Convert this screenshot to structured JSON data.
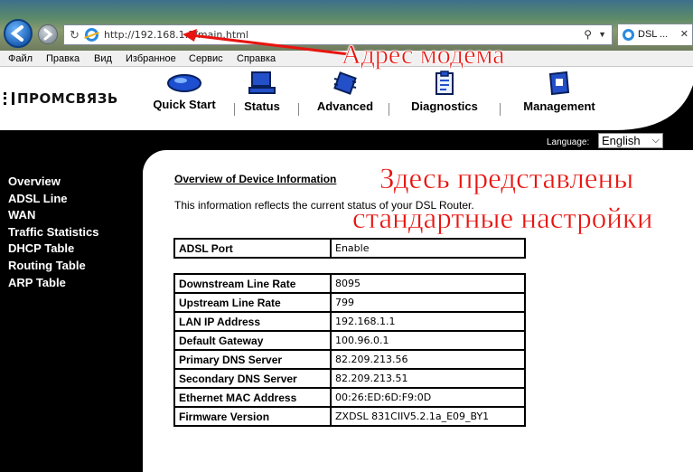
{
  "browser": {
    "url": "http://192.168.1.1/main.html",
    "tab_title": "DSL ...",
    "menu": [
      "Файл",
      "Правка",
      "Вид",
      "Избранное",
      "Сервис",
      "Справка"
    ]
  },
  "annotations": {
    "address_caption": "Адрес модема",
    "content_caption_line1": "Здесь представлены",
    "content_caption_line2": "стандартные настройки",
    "color": "#e8140f"
  },
  "router": {
    "brand": "ПРОМСВЯЗЬ",
    "nav": [
      {
        "label": "Quick Start",
        "icon": "mouse-icon"
      },
      {
        "label": "Status",
        "icon": "monitor-icon"
      },
      {
        "label": "Advanced",
        "icon": "chip-icon"
      },
      {
        "label": "Diagnostics",
        "icon": "clipboard-icon"
      },
      {
        "label": "Management",
        "icon": "book-icon"
      }
    ],
    "language_label": "Language:",
    "language_value": "English"
  },
  "sidebar": {
    "items": [
      "Overview",
      "ADSL Line",
      "WAN",
      "Traffic Statistics",
      "DHCP Table",
      "Routing Table",
      "ARP Table"
    ]
  },
  "main": {
    "title": "Overview of Device Information",
    "description": "This information reflects the current status of your DSL Router.",
    "port_table": [
      {
        "key": "ADSL Port",
        "value": "Enable"
      }
    ],
    "info_table": [
      {
        "key": "Downstream Line Rate",
        "value": "8095"
      },
      {
        "key": "Upstream Line Rate",
        "value": "799"
      },
      {
        "key": "LAN IP Address",
        "value": "192.168.1.1"
      },
      {
        "key": "Default Gateway",
        "value": "100.96.0.1"
      },
      {
        "key": "Primary DNS Server",
        "value": "82.209.213.56"
      },
      {
        "key": "Secondary DNS Server",
        "value": "82.209.213.51"
      },
      {
        "key": "Ethernet MAC Address",
        "value": "00:26:ED:6D:F9:0D"
      },
      {
        "key": "Firmware Version",
        "value": "ZXDSL 831CIIV5.2.1a_E09_BY1"
      }
    ]
  }
}
